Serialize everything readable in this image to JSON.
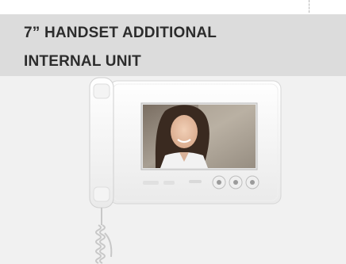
{
  "header": {
    "title_line1": "7” HANDSET ADDITIONAL",
    "title_line2": "INTERNAL UNIT"
  },
  "product": {
    "image": "handset-monitor-with-woman-on-screen",
    "colors": {
      "body": "#f7f7f7",
      "screen_border": "#dcdcdc",
      "cord": "#d0d0d0"
    }
  }
}
